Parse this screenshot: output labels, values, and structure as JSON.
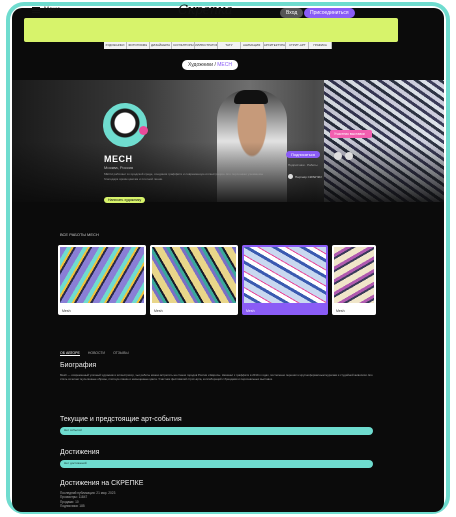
{
  "topbar": {
    "menu_label": "Меню",
    "logo": "Скрепка",
    "login_label": "Вход",
    "subscribe_label": "Присоединиться"
  },
  "categories": [
    "ХУДОЖНИКИ",
    "ФОТОГРАФЫ",
    "ДИЗАЙНЕРЫ",
    "СКУЛЬПТОРЫ",
    "ИЛЛЮСТРАТОРЫ",
    "ТАТУ",
    "АНИМАЦИЯ",
    "АРХИТЕКТУРА",
    "СТРИТ-АРТ",
    "ГРАФИКА"
  ],
  "breadcrumb": {
    "parent": "Художники",
    "sep": " / ",
    "current": "МЕСН"
  },
  "artist": {
    "name": "МЕСН",
    "city": "Москва, Россия",
    "bio_short": "МЕСН работает в городской среде, соединяя граффити и современную иллюстрацию. Его персонажи узнаваемы благодаря ярким цветам и плотной линии.",
    "write_label": "Написать художнику",
    "follow_label": "Подписаться",
    "stats": "Подписчики · Работы",
    "partner_label": "Партнёр СКРЕПКИ",
    "promo_tag": "Участник выставки"
  },
  "works": {
    "title": "ВСЕ РАБОТЫ МЕСН",
    "items": [
      {
        "caption": "Mesh",
        "colors": [
          "#8a7fd6",
          "#6fdccf",
          "#f0c23a"
        ]
      },
      {
        "caption": "Mesh",
        "colors": [
          "#e9d68a",
          "#7a6fc6",
          "#3aa89a"
        ]
      },
      {
        "caption": "Mesh",
        "colors": [
          "#c9d8f0",
          "#3a5ab0",
          "#e84a9a"
        ]
      },
      {
        "caption": "Mesh",
        "colors": [
          "#f0e6c9",
          "#b05ab0",
          "#3a3a5a"
        ]
      }
    ]
  },
  "tabs": [
    "ОБ АВТОРЕ",
    "НОВОСТИ",
    "ОТЗЫВЫ"
  ],
  "bio": {
    "title": "Биография",
    "text": "Меsh — современный уличный художник и иллюстратор, чьи работы можно встретить на стенах городов России и Европы. Начинал с граффити в 2010-х годах, постепенно перешёл к крупноформатным муралам и студийной живописи. Его стиль сочетает мультяшные образы, плотную линию и насыщенные цвета. Участник фестивалей стрит-арта, коллабораций с брендами и персональных выставок."
  },
  "events": {
    "title": "Текущие и предстоящие арт-события",
    "pill": "Нет событий"
  },
  "achievements": {
    "title": "Достижения",
    "pill": "Нет достижений"
  },
  "skrepka": {
    "title": "Достижения на СКРЕПКЕ",
    "lines": [
      "Последний публикация: 21 мар. 2023",
      "Просмотры: 11847",
      "Продажи: 10",
      "Подписчики: 185"
    ]
  }
}
